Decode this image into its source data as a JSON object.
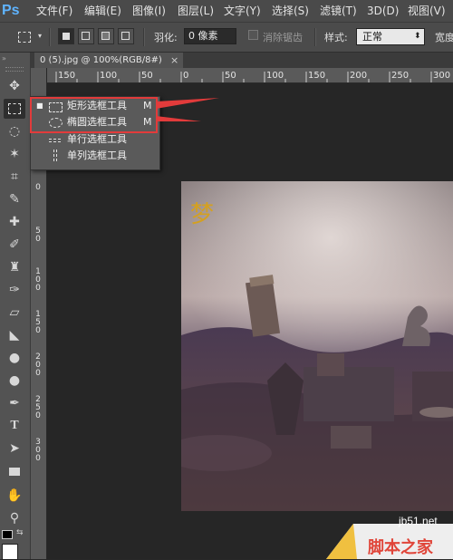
{
  "app": {
    "logo": "Ps"
  },
  "menubar": {
    "items": [
      {
        "label": "文件(F)"
      },
      {
        "label": "编辑(E)"
      },
      {
        "label": "图像(I)"
      },
      {
        "label": "图层(L)"
      },
      {
        "label": "文字(Y)"
      },
      {
        "label": "选择(S)"
      },
      {
        "label": "滤镜(T)"
      },
      {
        "label": "3D(D)"
      },
      {
        "label": "视图(V)"
      }
    ]
  },
  "options_bar": {
    "feather_label": "羽化:",
    "feather_value": "0 像素",
    "antialias_label": "消除锯齿",
    "style_label": "样式:",
    "style_value": "正常",
    "width_label": "宽度"
  },
  "document": {
    "tab_title": "0 (5).jpg @ 100%(RGB/8#)",
    "tab_close": "×"
  },
  "ruler": {
    "h_ticks": [
      "150",
      "100",
      "50",
      "0",
      "50",
      "100",
      "150",
      "200",
      "250",
      "300"
    ],
    "v_ticks": [
      {
        "d": [
          "0"
        ]
      },
      {
        "d": [
          "5",
          "0"
        ]
      },
      {
        "d": [
          "1",
          "0",
          "0"
        ]
      },
      {
        "d": [
          "1",
          "5",
          "0"
        ]
      },
      {
        "d": [
          "2",
          "0",
          "0"
        ]
      },
      {
        "d": [
          "2",
          "5",
          "0"
        ]
      },
      {
        "d": [
          "3",
          "0",
          "0"
        ]
      }
    ]
  },
  "flyout": {
    "items": [
      {
        "label": "矩形选框工具",
        "shortcut": "M",
        "icon": "rect-marquee-icon"
      },
      {
        "label": "椭圆选框工具",
        "shortcut": "M",
        "icon": "ellipse-marquee-icon"
      },
      {
        "label": "单行选框工具",
        "shortcut": "",
        "icon": "single-row-marquee-icon"
      },
      {
        "label": "单列选框工具",
        "shortcut": "",
        "icon": "single-column-marquee-icon"
      }
    ]
  },
  "image": {
    "overlay_text": "梦"
  },
  "watermark": {
    "site": "jb51.net",
    "name": "脚本之家"
  },
  "colors": {
    "highlight": "#e23b3b",
    "ps_blue": "#5fb4ff"
  }
}
